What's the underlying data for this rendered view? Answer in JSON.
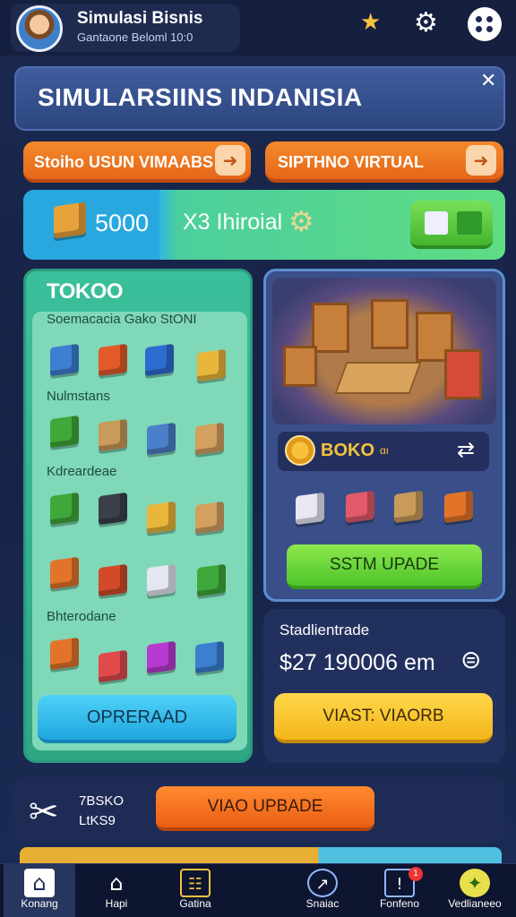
{
  "header": {
    "title": "Simulasi Bisnis",
    "subtitle": "Gantaone Beloml 10:0",
    "icons": [
      "trophy-icon",
      "gear-icon",
      "menu-icon"
    ]
  },
  "banner": {
    "title": "SIMULARSIINS INDANISIA",
    "close_icon": "close-icon"
  },
  "actions": {
    "left_label": "Stoiho USUN VIMAABS",
    "right_label": "SIPTHNO VIRTUAL"
  },
  "money": {
    "value": "5000",
    "rate": "X3 Ihiroial"
  },
  "store": {
    "title": "TOKOO",
    "subtitle": "Soemacacia Gako StONI",
    "categories": [
      "Nulmstans",
      "Kdreardeae",
      "Bhterodane"
    ],
    "button_label": "OPRERAAD"
  },
  "scene": {
    "coin_label": "BOKO",
    "coin_tag": "ɑı",
    "button_label": "SSTM UPADE"
  },
  "stats": {
    "title": "Stadlientrade",
    "value": "$27 190006 em",
    "button_label": "VIAST: VIAORB"
  },
  "bottom": {
    "line1": "7BSKO",
    "line2": "LtKS9",
    "button_label": "VIAO UPBADE"
  },
  "nav": {
    "items": [
      {
        "label": "Konang",
        "icon": "home-icon"
      },
      {
        "label": "Hapi",
        "icon": "shop-icon"
      },
      {
        "label": "Gatina",
        "icon": "calendar-icon"
      },
      {
        "label": "Snaiac",
        "icon": "compass-icon"
      },
      {
        "label": "Fonfeno",
        "icon": "clipboard-icon",
        "badge": "1"
      },
      {
        "label": "Vedlianeeo",
        "icon": "star-icon"
      }
    ]
  },
  "colors": {
    "accent_orange": "#f58a2a",
    "accent_green": "#4fc52a",
    "accent_blue": "#1fa6de",
    "accent_yellow": "#f3b51a"
  }
}
